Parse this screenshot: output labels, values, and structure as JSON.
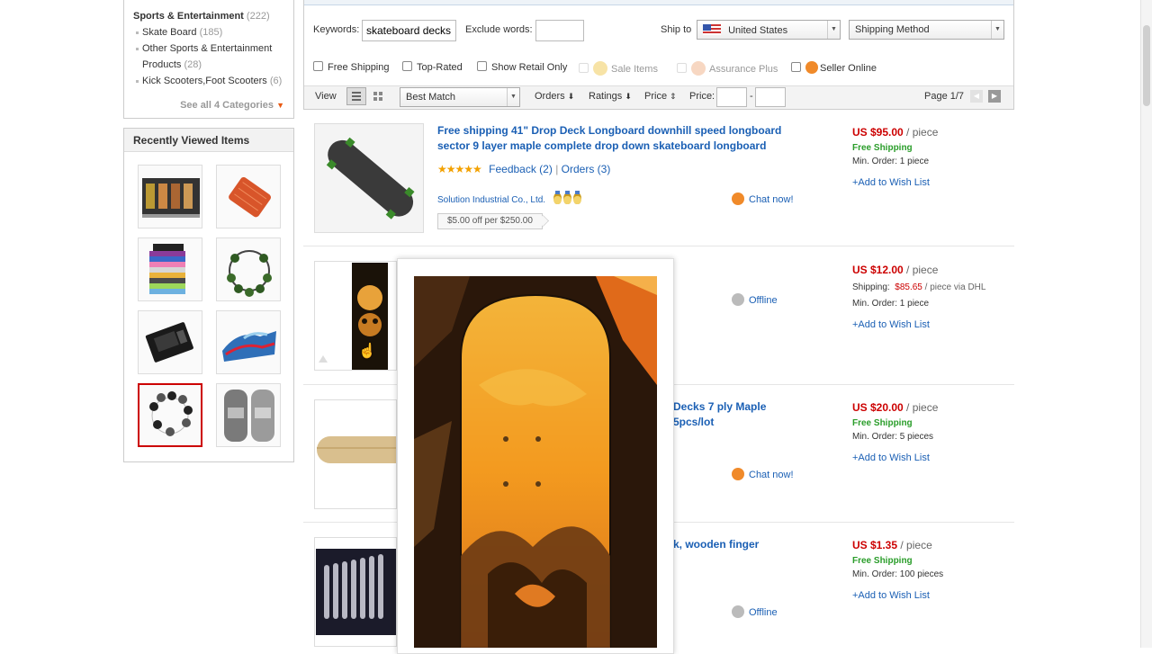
{
  "sidebar": {
    "category_main": {
      "label": "Sports & Entertainment",
      "count": "(222)"
    },
    "subcategories": [
      {
        "label": "Skate Board",
        "count": "(185)"
      },
      {
        "label": "Other Sports & Entertainment Products",
        "count": "(28)"
      },
      {
        "label": "Kick Scooters,Foot Scooters",
        "count": "(6)"
      }
    ],
    "see_all": "See all 4 Categories",
    "recently_viewed_title": "Recently Viewed Items"
  },
  "filters": {
    "keywords_label": "Keywords:",
    "keywords_value": "skateboard decks",
    "exclude_label": "Exclude words:",
    "exclude_value": "",
    "ship_to_label": "Ship to",
    "ship_to_value": "United States",
    "shipping_method": "Shipping Method",
    "checkboxes": {
      "free_shipping": "Free Shipping",
      "top_rated": "Top-Rated",
      "show_retail": "Show Retail Only",
      "sale_items": "Sale Items",
      "assurance_plus": "Assurance Plus",
      "seller_online": "Seller Online"
    }
  },
  "toolbar": {
    "view_label": "View",
    "sort_value": "Best Match",
    "orders": "Orders",
    "ratings": "Ratings",
    "price": "Price",
    "price_label": "Price:",
    "price_dash": "-",
    "page": "Page 1/7"
  },
  "products": [
    {
      "title_line1": "Free shipping 41\" Drop Deck Longboard downhill speed longboard",
      "title_line2": "sector 9 layer maple complete drop down skateboard longboard",
      "rating_stars": "★★★★★",
      "feedback": "Feedback (2)",
      "orders": "Orders (3)",
      "seller": "Solution Industrial Co., Ltd.",
      "coupon": "$5.00 off per $250.00",
      "status": "Chat now!",
      "price": "US $95.00",
      "unit": " / piece",
      "shipping": "Free Shipping",
      "min_order": "Min. Order: 1 piece",
      "wish": "+Add to Wish List"
    },
    {
      "status": "Offline",
      "price": "US $12.00",
      "unit": " / piece",
      "shipping_label": "Shipping:",
      "shipping_cost": "$85.65",
      "shipping_suffix": " / piece via DHL",
      "min_order": "Min. Order: 1 piece",
      "wish": "+Add to Wish List"
    },
    {
      "title_line1": "Decks 7 ply Maple",
      "title_line2": "5pcs/lot",
      "status": "Chat now!",
      "price": "US $20.00",
      "unit": " / piece",
      "shipping": "Free Shipping",
      "min_order": "Min. Order: 5 pieces",
      "wish": "+Add to Wish List"
    },
    {
      "title_line1": "k, wooden finger",
      "status": "Offline",
      "price": "US $1.35",
      "unit": " / piece",
      "shipping": "Free Shipping",
      "min_order": "Min. Order: 100 pieces",
      "wish": "+Add to Wish List"
    }
  ],
  "colors": {
    "price": "#cc0000",
    "link": "#1a5fb4",
    "free_shipping": "#2a9d2a",
    "accent_orange": "#e95a13"
  }
}
